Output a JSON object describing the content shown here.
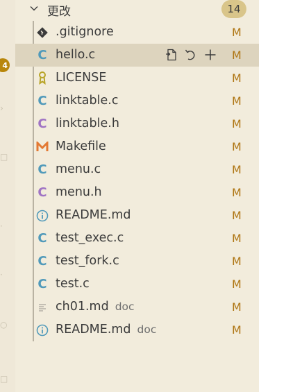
{
  "activity_badge": "4",
  "group": {
    "title": "更改",
    "count": "14"
  },
  "files": [
    {
      "name": ".gitignore",
      "desc": "",
      "status": "M",
      "icon": "git-icon",
      "color": "#3b3b3b",
      "selected": false
    },
    {
      "name": "hello.c",
      "desc": "",
      "status": "M",
      "icon": "c-file-icon",
      "color": "#519aba",
      "selected": true
    },
    {
      "name": "LICENSE",
      "desc": "",
      "status": "M",
      "icon": "license-icon",
      "color": "#b8a428",
      "selected": false
    },
    {
      "name": "linktable.c",
      "desc": "",
      "status": "M",
      "icon": "c-file-icon",
      "color": "#519aba",
      "selected": false
    },
    {
      "name": "linktable.h",
      "desc": "",
      "status": "M",
      "icon": "h-file-icon",
      "color": "#a074c4",
      "selected": false
    },
    {
      "name": "Makefile",
      "desc": "",
      "status": "M",
      "icon": "makefile-icon",
      "color": "#e37933",
      "selected": false
    },
    {
      "name": "menu.c",
      "desc": "",
      "status": "M",
      "icon": "c-file-icon",
      "color": "#519aba",
      "selected": false
    },
    {
      "name": "menu.h",
      "desc": "",
      "status": "M",
      "icon": "h-file-icon",
      "color": "#a074c4",
      "selected": false
    },
    {
      "name": "README.md",
      "desc": "",
      "status": "M",
      "icon": "info-icon",
      "color": "#519aba",
      "selected": false
    },
    {
      "name": "test_exec.c",
      "desc": "",
      "status": "M",
      "icon": "c-file-icon",
      "color": "#519aba",
      "selected": false
    },
    {
      "name": "test_fork.c",
      "desc": "",
      "status": "M",
      "icon": "c-file-icon",
      "color": "#519aba",
      "selected": false
    },
    {
      "name": "test.c",
      "desc": "",
      "status": "M",
      "icon": "c-file-icon",
      "color": "#519aba",
      "selected": false
    },
    {
      "name": "ch01.md",
      "desc": "doc",
      "status": "M",
      "icon": "text-file-icon",
      "color": "#b5b0a6",
      "selected": false
    },
    {
      "name": "README.md",
      "desc": "doc",
      "status": "M",
      "icon": "info-icon",
      "color": "#519aba",
      "selected": false
    }
  ],
  "row_actions": [
    "open-file-icon",
    "discard-changes-icon",
    "stage-changes-icon"
  ]
}
